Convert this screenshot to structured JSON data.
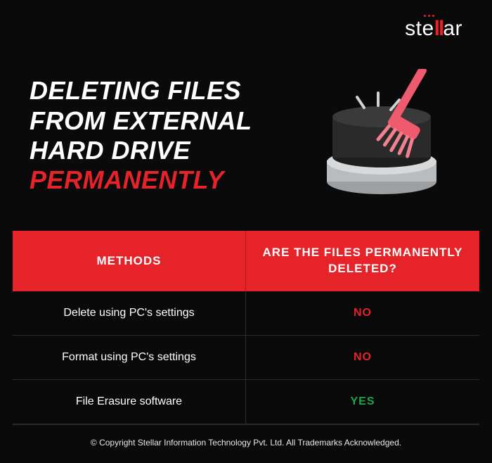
{
  "brand": {
    "name_pre": "ste",
    "name_mid": "ll",
    "name_post": "ar"
  },
  "title": {
    "line1": "DELETING FILES",
    "line2": "FROM EXTERNAL",
    "line3": "HARD DRIVE",
    "line4": "PERMANENTLY"
  },
  "table": {
    "header_left": "METHODS",
    "header_right": "ARE THE FILES PERMANENTLY DELETED?",
    "rows": [
      {
        "method": "Delete using PC's settings",
        "result": "NO",
        "result_class": "val-no"
      },
      {
        "method": "Format using PC's settings",
        "result": "NO",
        "result_class": "val-no"
      },
      {
        "method": "File Erasure software",
        "result": "YES",
        "result_class": "val-yes"
      }
    ]
  },
  "footer": {
    "copyright": "© Copyright Stellar Information Technology Pvt. Ltd. All Trademarks Acknowledged."
  },
  "icons": {
    "hard_drive": "hard-drive-icon",
    "broom": "broom-icon"
  }
}
